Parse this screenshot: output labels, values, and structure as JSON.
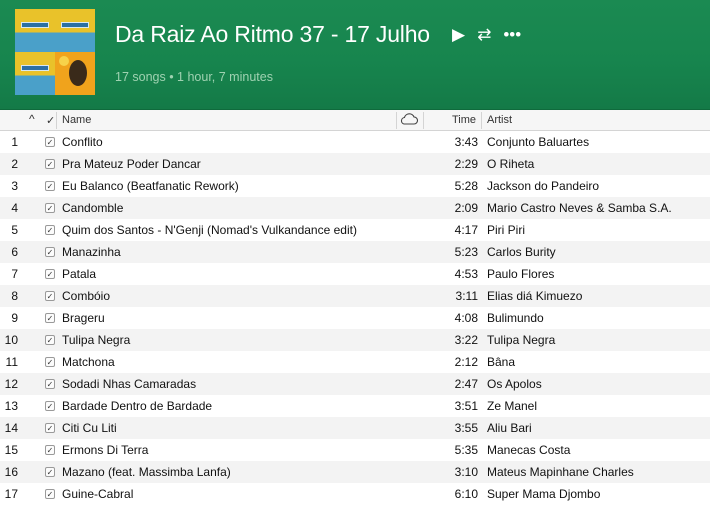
{
  "playlist": {
    "title": "Da Raiz Ao Ritmo 37 - 17 Julho",
    "subtitle": "17 songs • 1 hour, 7 minutes",
    "accent": "#17854e"
  },
  "controls": {
    "play_icon": "▶",
    "shuffle_icon": "⇄",
    "more_icon": "•••"
  },
  "columns": {
    "sort_icon": "^",
    "check_icon": "✓",
    "name": "Name",
    "cloud_icon": "cloud-icon",
    "time": "Time",
    "artist": "Artist"
  },
  "tracks": [
    {
      "num": "1",
      "name": "Conflito",
      "time": "3:43",
      "artist": "Conjunto Baluartes"
    },
    {
      "num": "2",
      "name": "Pra Mateuz Poder Dancar",
      "time": "2:29",
      "artist": "O Riheta"
    },
    {
      "num": "3",
      "name": "Eu Balanco (Beatfanatic Rework)",
      "time": "5:28",
      "artist": "Jackson do Pandeiro"
    },
    {
      "num": "4",
      "name": "Candomble",
      "time": "2:09",
      "artist": "Mario Castro Neves & Samba S.A."
    },
    {
      "num": "5",
      "name": "Quim dos Santos -  N'Genji (Nomad's Vulkandance edit)",
      "time": "4:17",
      "artist": "Piri Piri"
    },
    {
      "num": "6",
      "name": "Manazinha",
      "time": "5:23",
      "artist": "Carlos Burity"
    },
    {
      "num": "7",
      "name": "Patala",
      "time": "4:53",
      "artist": "Paulo Flores"
    },
    {
      "num": "8",
      "name": "Combóio",
      "time": "3:11",
      "artist": "Elias diá Kimuezo"
    },
    {
      "num": "9",
      "name": "Brageru",
      "time": "4:08",
      "artist": "Bulimundo"
    },
    {
      "num": "10",
      "name": "Tulipa Negra",
      "time": "3:22",
      "artist": "Tulipa Negra"
    },
    {
      "num": "11",
      "name": "Matchona",
      "time": "2:12",
      "artist": "Bâna"
    },
    {
      "num": "12",
      "name": "Sodadi Nhas Camaradas",
      "time": "2:47",
      "artist": "Os Apolos"
    },
    {
      "num": "13",
      "name": "Bardade Dentro de Bardade",
      "time": "3:51",
      "artist": "Ze Manel"
    },
    {
      "num": "14",
      "name": "Citi Cu Liti",
      "time": "3:55",
      "artist": "Aliu Bari"
    },
    {
      "num": "15",
      "name": "Ermons Di Terra",
      "time": "5:35",
      "artist": "Manecas Costa"
    },
    {
      "num": "16",
      "name": "Mazano (feat. Massimba Lanfa)",
      "time": "3:10",
      "artist": "Mateus Mapinhane Charles"
    },
    {
      "num": "17",
      "name": "Guine-Cabral",
      "time": "6:10",
      "artist": "Super Mama Djombo"
    }
  ]
}
